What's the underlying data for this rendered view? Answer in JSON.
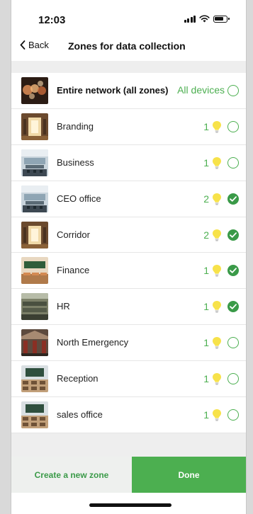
{
  "status_bar": {
    "time": "12:03",
    "icons": [
      "signal-icon",
      "wifi-icon",
      "battery-icon"
    ]
  },
  "nav": {
    "back_label": "Back",
    "title": "Zones for data collection",
    "back_icon": "chevron-left-icon"
  },
  "all_zones": {
    "label": "Entire network (all zones)",
    "value": "All devices",
    "selected": false
  },
  "zones": [
    {
      "name": "Branding",
      "count": "1",
      "selected": false,
      "thumb": "lobby"
    },
    {
      "name": "Business",
      "count": "1",
      "selected": false,
      "thumb": "meeting"
    },
    {
      "name": "CEO office",
      "count": "2",
      "selected": true,
      "thumb": "meeting"
    },
    {
      "name": "Corridor",
      "count": "2",
      "selected": true,
      "thumb": "lobby"
    },
    {
      "name": "Finance",
      "count": "1",
      "selected": true,
      "thumb": "classroom"
    },
    {
      "name": "HR",
      "count": "1",
      "selected": true,
      "thumb": "office"
    },
    {
      "name": "North Emergency",
      "count": "1",
      "selected": false,
      "thumb": "warehouse"
    },
    {
      "name": "Reception",
      "count": "1",
      "selected": false,
      "thumb": "classroom2"
    },
    {
      "name": "sales office",
      "count": "1",
      "selected": false,
      "thumb": "classroom2"
    }
  ],
  "footer": {
    "create_label": "Create a new zone",
    "done_label": "Done"
  },
  "colors": {
    "accent": "#4caf50",
    "accent_dark": "#3a9a48",
    "bulb": "#f7e24a"
  }
}
